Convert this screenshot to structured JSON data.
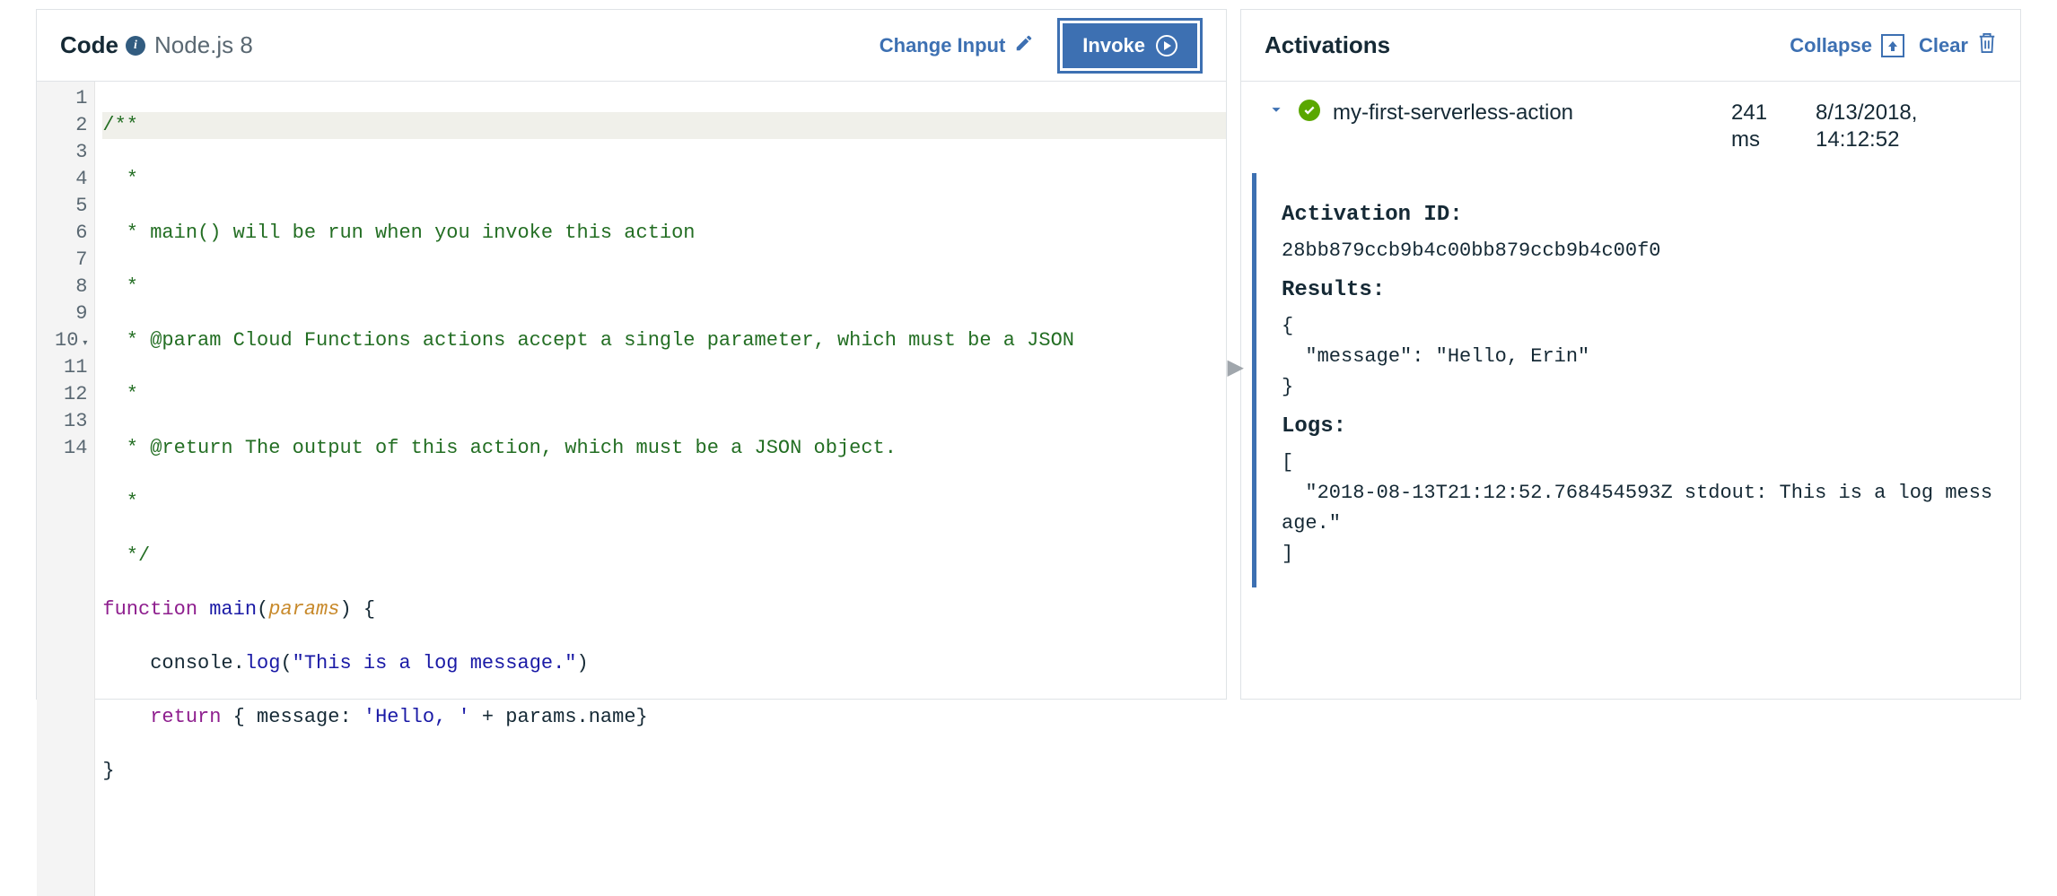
{
  "left": {
    "title": "Code",
    "runtime": "Node.js 8",
    "changeInputLabel": "Change Input",
    "invokeLabel": "Invoke"
  },
  "code": {
    "lines": [
      "/**",
      "  *",
      "  * main() will be run when you invoke this action",
      "  *",
      "  * @param Cloud Functions actions accept a single parameter, which must be a JSON",
      "  *",
      "  * @return The output of this action, which must be a JSON object.",
      "  *",
      "  */",
      "function main(params) {",
      "    console.log(\"This is a log message.\")",
      "    return { message: 'Hello, ' + params.name}",
      "}",
      ""
    ],
    "lineNumbers": [
      "1",
      "2",
      "3",
      "4",
      "5",
      "6",
      "7",
      "8",
      "9",
      "10",
      "11",
      "12",
      "13",
      "14"
    ]
  },
  "right": {
    "title": "Activations",
    "collapseLabel": "Collapse",
    "clearLabel": "Clear"
  },
  "activation": {
    "name": "my-first-serverless-action",
    "durationValue": "241",
    "durationUnit": "ms",
    "dateLine1": "8/13/2018,",
    "dateLine2": "14:12:52",
    "idLabel": "Activation ID:",
    "id": "28bb879ccb9b4c00bb879ccb9b4c00f0",
    "resultsLabel": "Results:",
    "resultsBody": "{\n  \"message\": \"Hello, Erin\"\n}",
    "logsLabel": "Logs:",
    "logsBody": "[\n  \"2018-08-13T21:12:52.768454593Z stdout: This is a log message.\"\n]"
  }
}
